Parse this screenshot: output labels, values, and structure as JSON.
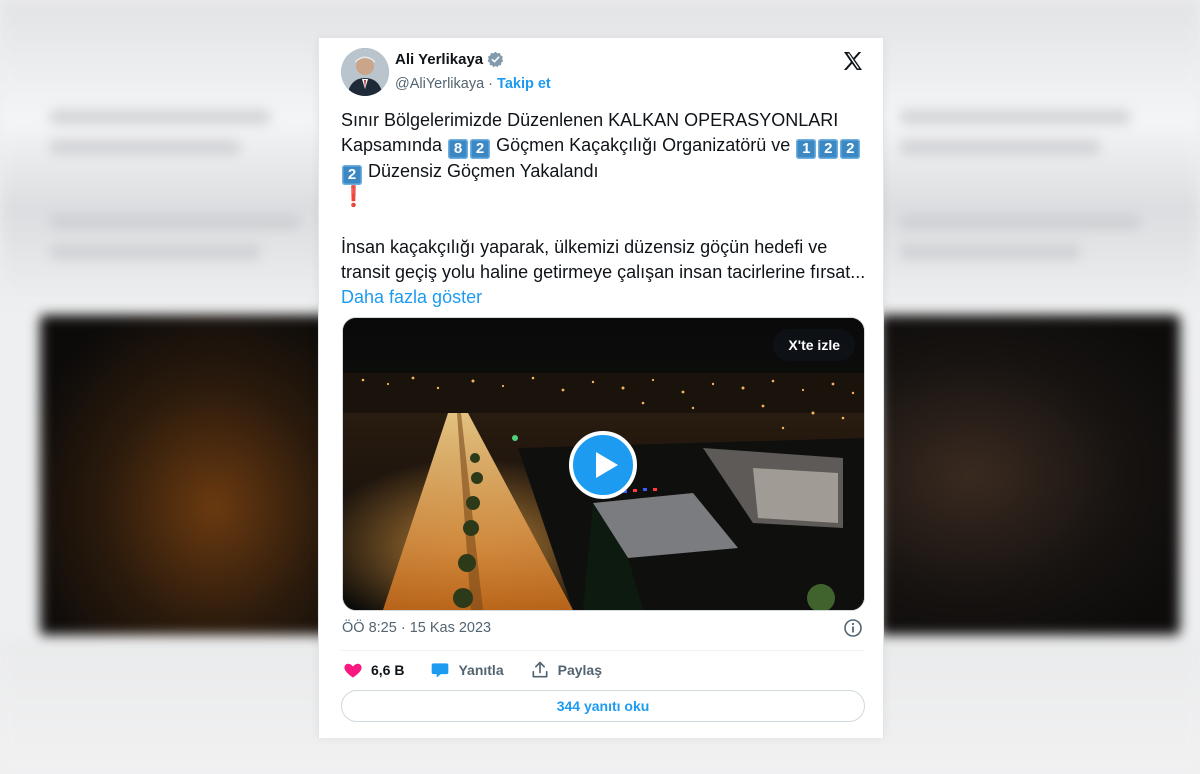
{
  "tweet": {
    "author_name": "Ali Yerlikaya",
    "handle": "@AliYerlikaya",
    "separator": "·",
    "follow_label": "Takip et",
    "text": {
      "p1_a": "Sınır Bölgelerimizde Düzenlenen KALKAN OPERASYONLARI Kapsamında",
      "p1_num1": [
        "8",
        "2"
      ],
      "p1_b": "Göçmen Kaçakçılığı Organizatörü ve",
      "p1_num2": [
        "1",
        "2",
        "2",
        "2"
      ],
      "p1_c": "Düzensiz Göçmen Yakalandı",
      "p1_excl": "❗",
      "p2": "İnsan kaçakçılığı yaparak, ülkemizi düzensiz göçün hedefi ve transit geçiş yolu haline getirmeye çalışan insan tacirlerine fırsat...",
      "show_more": "Daha fazla göster"
    },
    "video": {
      "watch_label": "X'te izle"
    },
    "timestamp": "ÖÖ 8:25 · 15 Kas 2023",
    "actions": {
      "likes": "6,6 B",
      "reply_label": "Yanıtla",
      "share_label": "Paylaş"
    },
    "read_replies": "344 yanıtı oku",
    "colors": {
      "accent": "#1d9bf0",
      "like": "#f91880",
      "keycap": "#3b88c3"
    }
  }
}
